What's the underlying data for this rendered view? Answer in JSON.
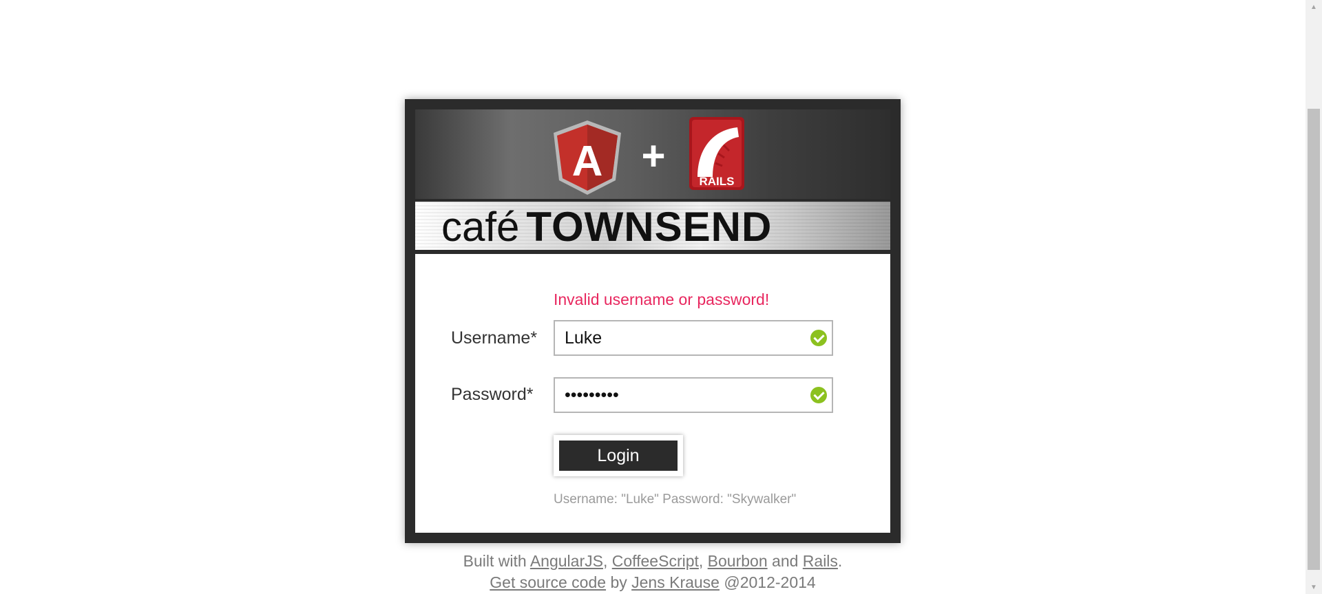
{
  "header": {
    "angular_logo_letter": "A",
    "plus_symbol": "+",
    "rails_logo_text": "RAILS"
  },
  "banner": {
    "cafe": "café",
    "townsend": "TOWNSEND"
  },
  "form": {
    "error_message": "Invalid username or password!",
    "username_label": "Username*",
    "username_value": "Luke",
    "password_label": "Password*",
    "password_value": "•••••••••",
    "login_label": "Login",
    "hint": "Username: \"Luke\" Password: \"Skywalker\""
  },
  "footer": {
    "built_with": "Built with",
    "angularjs": "AngularJS",
    "sep1": ",",
    "coffeescript": "CoffeeScript",
    "sep2": ",",
    "bourbon": "Bourbon",
    "and": "and",
    "rails": "Rails",
    "period": ".",
    "get_source": "Get source code",
    "by": "by",
    "author": "Jens Krause",
    "copyright": "@2012-2014"
  },
  "colors": {
    "error": "#e8265e",
    "valid_check": "#8cc11f",
    "dark": "#2b2b2b",
    "angular_red": "#c3302a",
    "rails_red": "#a8161c"
  }
}
